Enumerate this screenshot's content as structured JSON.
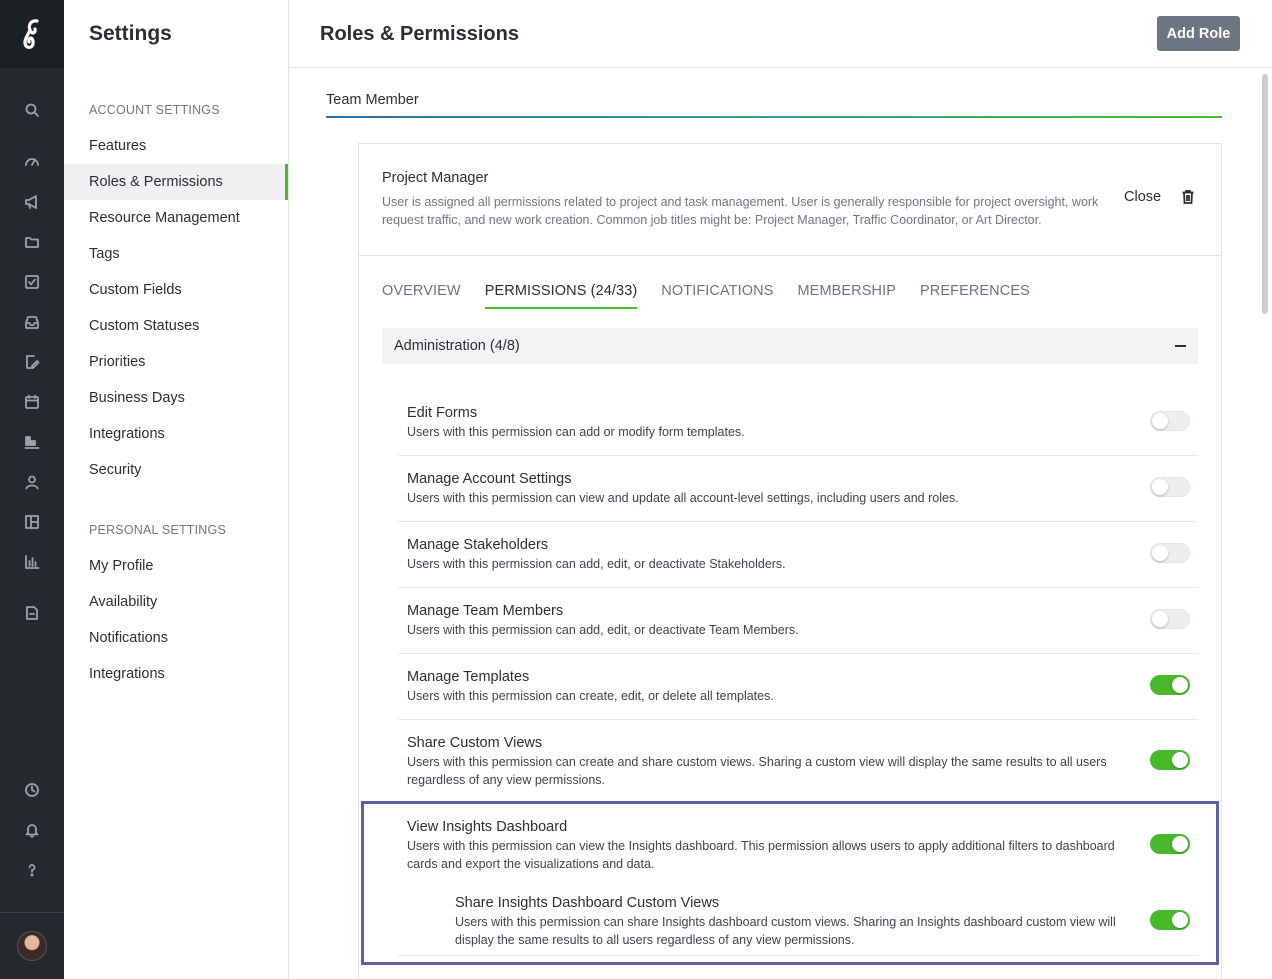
{
  "rail": {
    "icons": [
      "search-icon",
      "dashboard-icon",
      "megaphone-icon",
      "folder-icon",
      "checkbox-icon",
      "inbox-icon",
      "edit-doc-icon",
      "calendar-icon",
      "board-icon",
      "user-icon",
      "layout-icon",
      "bar-chart-icon",
      "document-icon",
      "clock-icon",
      "bell-icon",
      "help-icon"
    ]
  },
  "sidebar": {
    "title": "Settings",
    "account_heading": "ACCOUNT SETTINGS",
    "account_items": [
      {
        "label": "Features"
      },
      {
        "label": "Roles & Permissions"
      },
      {
        "label": "Resource Management"
      },
      {
        "label": "Tags"
      },
      {
        "label": "Custom Fields"
      },
      {
        "label": "Custom Statuses"
      },
      {
        "label": "Priorities"
      },
      {
        "label": "Business Days"
      },
      {
        "label": "Integrations"
      },
      {
        "label": "Security"
      }
    ],
    "personal_heading": "PERSONAL SETTINGS",
    "personal_items": [
      {
        "label": "My Profile"
      },
      {
        "label": "Availability"
      },
      {
        "label": "Notifications"
      },
      {
        "label": "Integrations"
      }
    ]
  },
  "header": {
    "title": "Roles & Permissions",
    "add_role_label": "Add Role"
  },
  "role_tab": "Team Member",
  "role": {
    "name": "Project Manager",
    "description": "User is assigned all permissions related to project and task management. User is generally responsible for project oversight, work request traffic, and new work creation. Common job titles might be: Project Manager, Traffic Coordinator, or Art Director.",
    "close_label": "Close"
  },
  "tabs": [
    {
      "label": "OVERVIEW",
      "active": false
    },
    {
      "label": "PERMISSIONS (24/33)",
      "active": true
    },
    {
      "label": "NOTIFICATIONS",
      "active": false
    },
    {
      "label": "MEMBERSHIP",
      "active": false
    },
    {
      "label": "PREFERENCES",
      "active": false
    }
  ],
  "group": {
    "label": "Administration (4/8)",
    "expanded": true
  },
  "permissions": [
    {
      "name": "Edit Forms",
      "description": "Users with this permission can add or modify form templates.",
      "enabled": false
    },
    {
      "name": "Manage Account Settings",
      "description": "Users with this permission can view and update all account-level settings, including users and roles.",
      "enabled": false
    },
    {
      "name": "Manage Stakeholders",
      "description": "Users with this permission can add, edit, or deactivate Stakeholders.",
      "enabled": false
    },
    {
      "name": "Manage Team Members",
      "description": "Users with this permission can add, edit, or deactivate Team Members.",
      "enabled": false
    },
    {
      "name": "Manage Templates",
      "description": "Users with this permission can create, edit, or delete all templates.",
      "enabled": true
    },
    {
      "name": "Share Custom Views",
      "description": "Users with this permission can create and share custom views. Sharing a custom view will display the same results to all users regardless of any view permissions.",
      "enabled": true
    },
    {
      "name": "View Insights Dashboard",
      "description": "Users with this permission can view the Insights dashboard. This permission allows users to apply additional filters to dashboard cards and export the visualizations and data.",
      "enabled": true
    },
    {
      "name": "Share Insights Dashboard Custom Views",
      "description": "Users with this permission can share Insights dashboard custom views. Sharing an Insights dashboard custom view will display the same results to all users regardless of any view permissions.",
      "enabled": true
    }
  ],
  "colors": {
    "rail_bg": "#24292e",
    "accent_green": "#49b92c",
    "button_gray": "#6b7681",
    "highlight_border": "#5a5fa6"
  }
}
